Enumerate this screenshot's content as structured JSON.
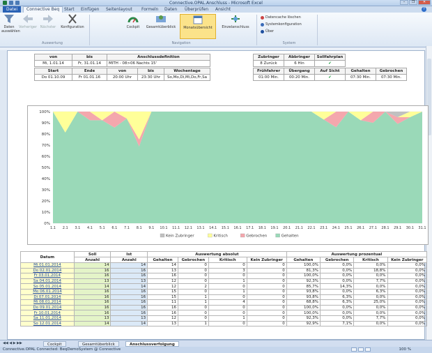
{
  "window": {
    "title": "Connective.OPAL.Anschluss - Microsoft Excel",
    "controls": [
      "–",
      "❐",
      "✕"
    ]
  },
  "tabs": {
    "file": "Datei",
    "items": [
      "Connective Beq",
      "Start",
      "Einfügen",
      "Seitenlayout",
      "Formeln",
      "Daten",
      "Überprüfen",
      "Ansicht"
    ],
    "help": "?"
  },
  "ribbon": {
    "daten_auswaehlen": "Daten auswählen",
    "vorheriger": "Vorheriger",
    "naechster": "Nächster",
    "konfiguration": "Konfiguration",
    "cockpit": "Cockpit",
    "gesamtuberblick": "Gesamtüberblick",
    "monatsubersicht": "Monatsübersicht",
    "einzelanschluss": "Einzelanschluss",
    "cache": "Datencache löschen",
    "syskonf": "Systemkonfiguration",
    "ueber": "Über",
    "grp_auswertung": "Auswertung",
    "grp_navigation": "Navigation",
    "grp_system": "System"
  },
  "header1": {
    "von_h": "von",
    "bis_h": "bis",
    "def_h": "Anschlussdefinition",
    "von": "Mi, 1.01.14",
    "bis": "Fr, 31.01.14",
    "def": "MITH - 08>06 Nachts 15'",
    "zub_h": "Zubringer",
    "abb_h": "Abbringer",
    "soll_h": "Sollfahrplan",
    "zub": "8 Zurück",
    "abb": "6 Hin",
    "soll": "✔"
  },
  "header2": {
    "start_h": "Start",
    "ende_h": "Ende",
    "von_h": "von",
    "bis_h": "bis",
    "wt_h": "Wochentage",
    "start": "Do 01.10.09",
    "ende": "Fr 01.01.16",
    "von": "20:00 Uhr",
    "bis": "23:30 Uhr",
    "wt": "So,Mo,Di,Mi,Do,Fr,Sa",
    "fr_h": "Frühfahrer",
    "ue_h": "Übergang",
    "as_h": "Auf Sicht",
    "ge_h": "Gehalten",
    "gb_h": "Gebrochen",
    "fr": "01:00 Min.",
    "ue": "00:20 Min.",
    "as": "✔",
    "ge": "07:30 Min.",
    "gb": "07:30 Min."
  },
  "chart_data": {
    "type": "area",
    "x": [
      "1.1",
      "2.1",
      "3.1",
      "4.1",
      "5.1",
      "6.1",
      "7.1",
      "8.1",
      "9.1",
      "10.1",
      "11.1",
      "12.1",
      "13.1",
      "14.1",
      "15.1",
      "16.1",
      "17.1",
      "18.1",
      "19.1",
      "20.1",
      "21.1",
      "22.1",
      "23.1",
      "24.1",
      "25.1",
      "26.1",
      "27.1",
      "28.1",
      "29.1",
      "30.1",
      "31.1"
    ],
    "series": [
      {
        "name": "Kein Zubringer",
        "color": "#c0c0c0",
        "values": [
          0,
          0,
          0,
          0,
          0,
          0,
          0,
          0,
          0,
          0,
          0,
          0,
          0,
          0,
          0,
          0,
          0,
          0,
          0,
          0,
          0,
          0,
          0,
          0,
          0,
          0,
          0,
          0,
          5,
          0,
          0
        ]
      },
      {
        "name": "Kritisch",
        "color": "#ffff99",
        "values": [
          0,
          18.8,
          0,
          0,
          7.7,
          0,
          6.3,
          25,
          0,
          0,
          0,
          0,
          0,
          0,
          0,
          0,
          0,
          0,
          0,
          0,
          0,
          0,
          7.1,
          0,
          0,
          7.7,
          0,
          0,
          0,
          5,
          0
        ]
      },
      {
        "name": "Gebrochen",
        "color": "#f4a7ad",
        "values": [
          0,
          0,
          0,
          7.7,
          0,
          14.3,
          0,
          6.3,
          0,
          0,
          0,
          0,
          0,
          0,
          0,
          0,
          0,
          0,
          0,
          0,
          0,
          0,
          0,
          14,
          0,
          0,
          10,
          0,
          6,
          0,
          0
        ]
      },
      {
        "name": "Gehalten",
        "color": "#9ad9b8",
        "values": [
          100,
          81.3,
          100,
          92.3,
          92.3,
          85.7,
          93.8,
          68.8,
          100,
          100,
          100,
          100,
          100,
          100,
          100,
          100,
          100,
          100,
          100,
          100,
          100,
          100,
          92.9,
          86,
          100,
          92.3,
          90,
          100,
          89,
          95,
          100
        ]
      }
    ],
    "yticks": [
      "0%",
      "10%",
      "20%",
      "30%",
      "40%",
      "50%",
      "60%",
      "70%",
      "80%",
      "90%",
      "100%"
    ],
    "ylim": [
      0,
      100
    ],
    "legend": "bottom"
  },
  "table": {
    "h_datum": "Datum",
    "h_soll": "Soll",
    "h_anzahl": "Anzahl",
    "h_ist": "Ist",
    "h_abs": "Auswertung absolut",
    "h_proz": "Auswertung prozentual",
    "h_gehalten": "Gehalten",
    "h_gebrochen": "Gebrochen",
    "h_kritisch": "Kritisch",
    "h_kein": "Kein Zubringer",
    "rows": [
      [
        "Mi 01.01.2014",
        "14",
        "14",
        "14",
        "0",
        "0",
        "0",
        "100,0%",
        "0,0%",
        "0,0%",
        "0,0%"
      ],
      [
        "Do 02.01.2014",
        "16",
        "16",
        "13",
        "0",
        "3",
        "0",
        "81,3%",
        "0,0%",
        "18,8%",
        "0,0%"
      ],
      [
        "Fr 03.01.2014",
        "16",
        "16",
        "16",
        "0",
        "0",
        "0",
        "100,0%",
        "0,0%",
        "0,0%",
        "0,0%"
      ],
      [
        "Sa 04.01.2014",
        "13",
        "13",
        "12",
        "0",
        "1",
        "0",
        "92,3%",
        "0,0%",
        "7,7%",
        "0,0%"
      ],
      [
        "So 05.01.2014",
        "14",
        "14",
        "12",
        "2",
        "0",
        "0",
        "85,7%",
        "14,3%",
        "0,0%",
        "0,0%"
      ],
      [
        "Mo 06.01.2014",
        "16",
        "16",
        "15",
        "0",
        "1",
        "0",
        "93,8%",
        "0,0%",
        "6,3%",
        "0,0%"
      ],
      [
        "Di 07.01.2014",
        "16",
        "16",
        "15",
        "1",
        "0",
        "0",
        "93,8%",
        "6,3%",
        "0,0%",
        "0,0%"
      ],
      [
        "Mi 08.01.2014",
        "16",
        "16",
        "11",
        "1",
        "4",
        "0",
        "68,8%",
        "6,3%",
        "25,0%",
        "0,0%"
      ],
      [
        "Do 09.01.2014",
        "16",
        "16",
        "16",
        "0",
        "0",
        "0",
        "100,0%",
        "0,0%",
        "0,0%",
        "0,0%"
      ],
      [
        "Fr 10.01.2014",
        "16",
        "16",
        "16",
        "0",
        "0",
        "0",
        "100,0%",
        "0,0%",
        "0,0%",
        "0,0%"
      ],
      [
        "Sa 11.01.2014",
        "13",
        "13",
        "12",
        "0",
        "1",
        "0",
        "92,3%",
        "0,0%",
        "7,7%",
        "0,0%"
      ],
      [
        "So 12.01.2014",
        "14",
        "14",
        "13",
        "1",
        "0",
        "0",
        "92,9%",
        "7,1%",
        "0,0%",
        "0,0%"
      ]
    ]
  },
  "sheets": {
    "items": [
      "Cockpit",
      "Gesamtüberblick",
      "Anschlussverfolgung"
    ],
    "active": 2
  },
  "status": {
    "left": "Connective.OPAL Connected: BeqDemoSystem @ Connective",
    "zoom": "100 %"
  }
}
